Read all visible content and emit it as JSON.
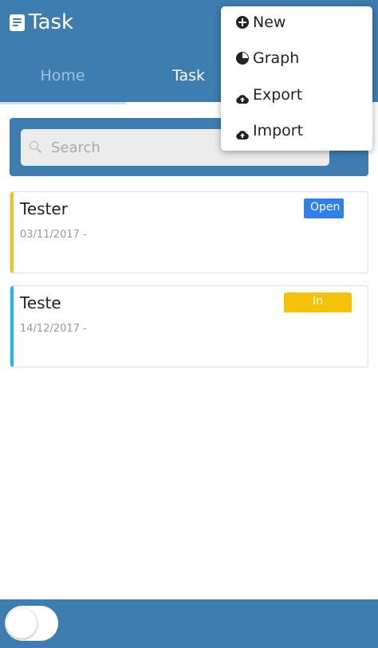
{
  "header": {
    "title": "Task",
    "tabs": [
      {
        "label": "Home",
        "active": false
      },
      {
        "label": "Task",
        "active": true
      }
    ]
  },
  "search": {
    "placeholder": "Search",
    "value": ""
  },
  "tasks": [
    {
      "title": "Tester",
      "date": "03/11/2017 -",
      "status": "Open",
      "status_color": "#2f80ed",
      "accent": "#f3c324"
    },
    {
      "title": "Teste",
      "date": "14/12/2017 -",
      "status": "In process",
      "status_color": "#f5c20a",
      "accent": "#2db4e6"
    }
  ],
  "menu": {
    "items": [
      {
        "label": "New",
        "icon": "plus-circle-icon"
      },
      {
        "label": "Graph",
        "icon": "pie-chart-icon"
      },
      {
        "label": "Export",
        "icon": "cloud-upload-icon"
      },
      {
        "label": "Import",
        "icon": "cloud-upload-icon"
      }
    ]
  },
  "footer": {
    "toggle_on": false
  },
  "colors": {
    "primary": "#3e7db0",
    "open": "#2f80ed",
    "in_process": "#f5c20a"
  }
}
